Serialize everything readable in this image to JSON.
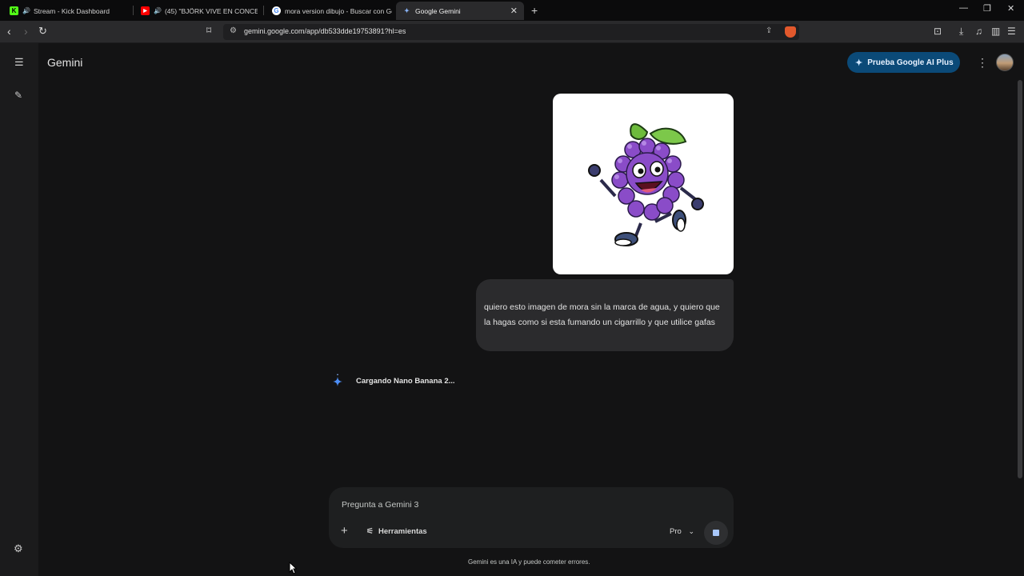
{
  "browser": {
    "tabs": [
      {
        "title": "Stream - Kick Dashboard",
        "audio": true
      },
      {
        "title": "(45) \"BJÖRK VIVE EN CONCEPCIÓ",
        "audio": true
      },
      {
        "title": "mora version dibujo - Buscar con Go",
        "audio": false
      },
      {
        "title": "Google Gemini",
        "active": true
      }
    ],
    "url": "gemini.google.com/app/db533dde19753891?hl=es"
  },
  "app": {
    "name": "Gemini",
    "promo_label": "Prueba Google AI Plus",
    "accent": "#0b4a78"
  },
  "conversation": {
    "user_message": "quiero esto imagen de mora sin la marca de agua, y quiero que la hagas como si esta fumando un cigarrillo y que utilice gafas",
    "status": "Cargando Nano Banana 2..."
  },
  "composer": {
    "placeholder": "Pregunta a Gemini 3",
    "tools_label": "Herramientas",
    "mode_label": "Pro"
  },
  "footer": {
    "disclaimer": "Gemini es una IA y puede cometer errores."
  }
}
